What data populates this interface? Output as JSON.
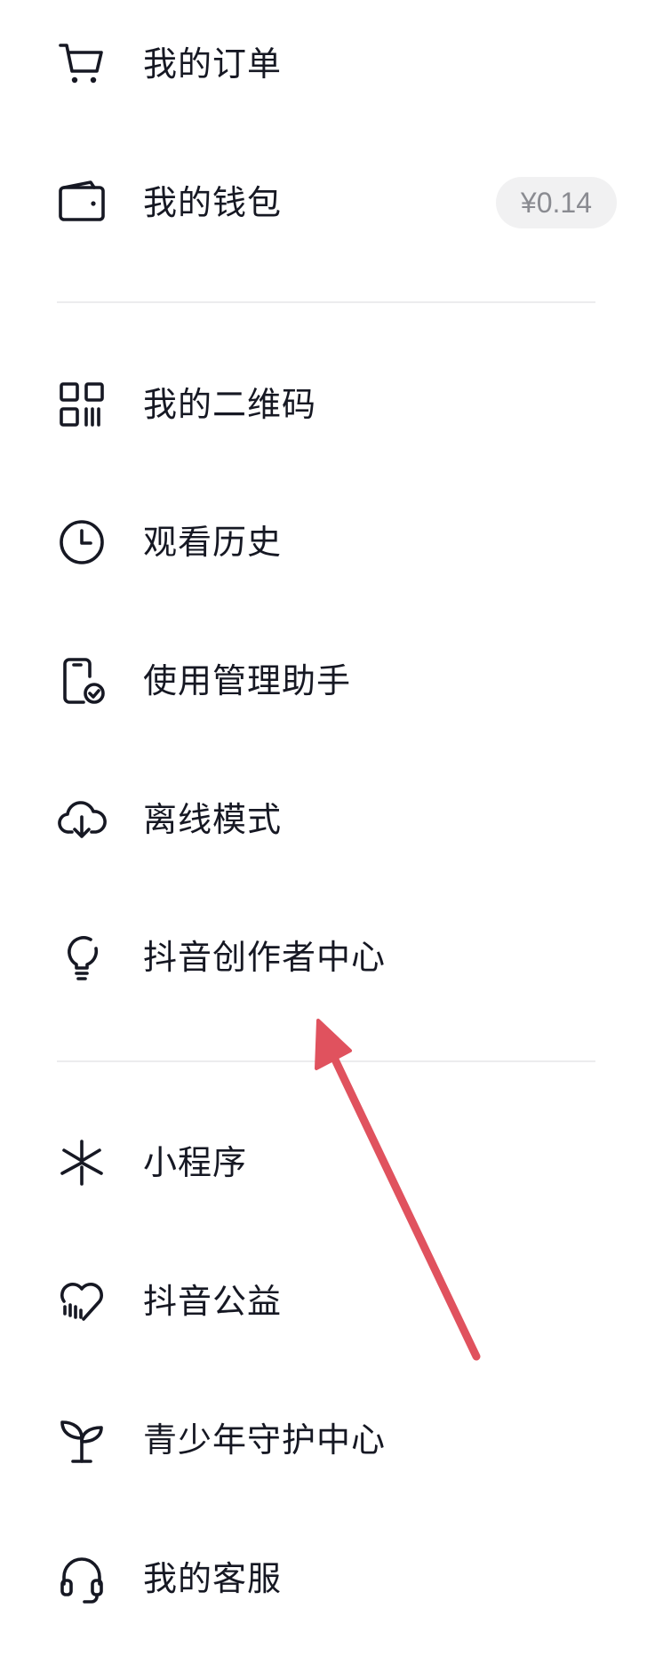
{
  "menu": {
    "orders": {
      "label": "我的订单",
      "icon": "cart-icon"
    },
    "wallet": {
      "label": "我的钱包",
      "icon": "wallet-icon",
      "badge": "¥0.14"
    },
    "qrcode": {
      "label": "我的二维码",
      "icon": "qrcode-icon"
    },
    "history": {
      "label": "观看历史",
      "icon": "clock-icon"
    },
    "usage_manager": {
      "label": "使用管理助手",
      "icon": "phone-check-icon"
    },
    "offline": {
      "label": "离线模式",
      "icon": "cloud-download-icon"
    },
    "creator_center": {
      "label": "抖音创作者中心",
      "icon": "lightbulb-icon"
    },
    "mini_programs": {
      "label": "小程序",
      "icon": "mini-program-icon"
    },
    "charity": {
      "label": "抖音公益",
      "icon": "heart-icon"
    },
    "youth_protection": {
      "label": "青少年守护中心",
      "icon": "sprout-icon"
    },
    "customer_service": {
      "label": "我的客服",
      "icon": "headset-icon"
    }
  },
  "colors": {
    "text": "#161823",
    "icon": "#161823",
    "badge_bg": "#f1f1f2",
    "badge_text": "#8a8b91",
    "divider": "#ececee",
    "annotation_arrow": "#e0525e"
  }
}
